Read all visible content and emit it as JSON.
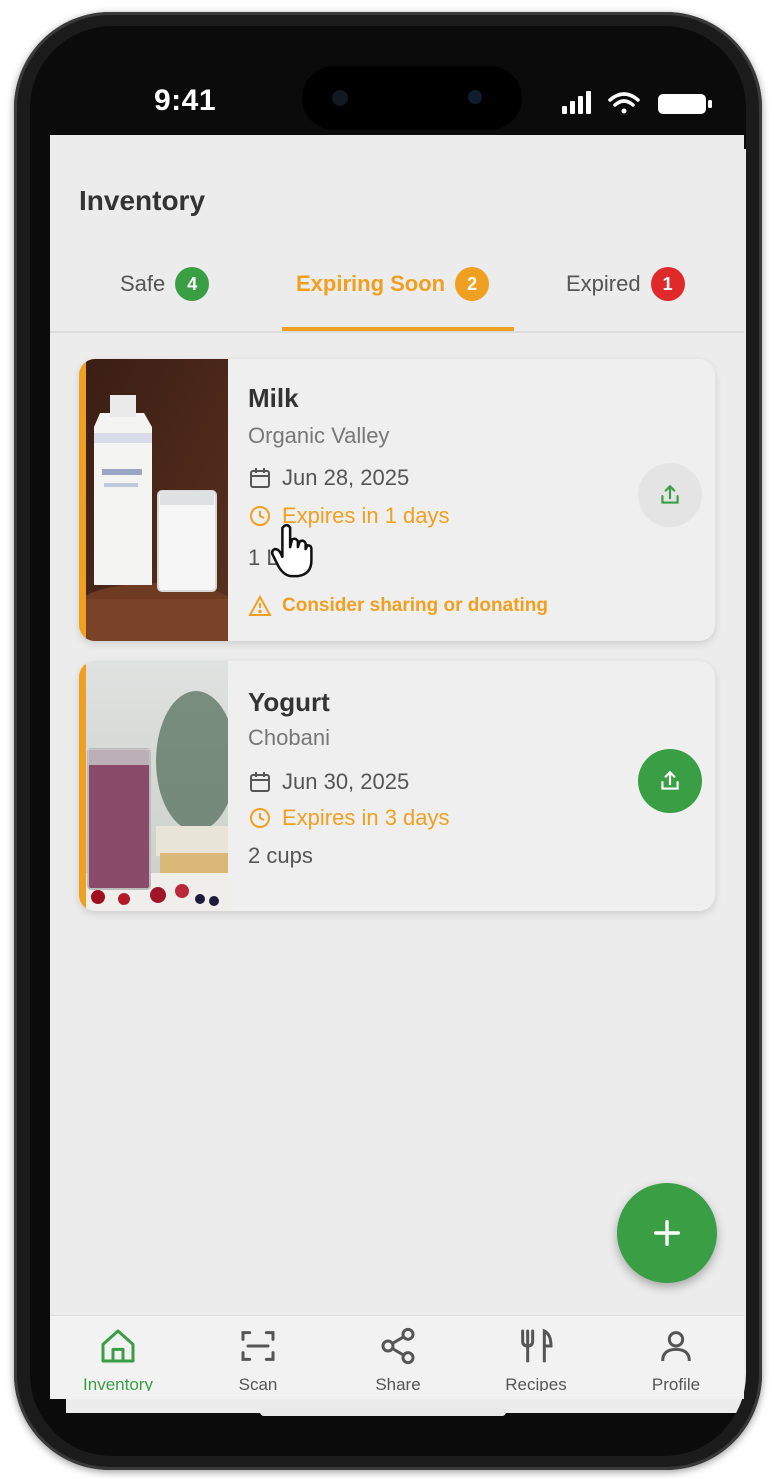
{
  "status_bar": {
    "time": "9:41"
  },
  "header": {
    "title": "Inventory"
  },
  "tabs": [
    {
      "label": "Safe",
      "count": "4",
      "color": "#3a9e45"
    },
    {
      "label": "Expiring Soon",
      "count": "2",
      "color": "#f0a020",
      "active": true
    },
    {
      "label": "Expired",
      "count": "1",
      "color": "#e02a2a"
    }
  ],
  "items": [
    {
      "name": "Milk",
      "brand": "Organic Valley",
      "date": "Jun 28, 2025",
      "expires": "Expires in 1 days",
      "quantity": "1 L",
      "warning": "Consider sharing or donating",
      "image_icon": "milk-carton-image"
    },
    {
      "name": "Yogurt",
      "brand": "Chobani",
      "date": "Jun 30, 2025",
      "expires": "Expires in 3 days",
      "quantity": "2 cups",
      "image_icon": "smoothie-glass-image"
    }
  ],
  "nav": [
    {
      "label": "Inventory",
      "icon": "home-icon",
      "active": true
    },
    {
      "label": "Scan",
      "icon": "scan-icon"
    },
    {
      "label": "Share",
      "icon": "share-icon"
    },
    {
      "label": "Recipes",
      "icon": "utensils-icon"
    },
    {
      "label": "Profile",
      "icon": "user-icon"
    }
  ],
  "colors": {
    "accent": "#f0a020",
    "primary": "#3a9e45",
    "danger": "#e02a2a",
    "background": "#ececec"
  }
}
